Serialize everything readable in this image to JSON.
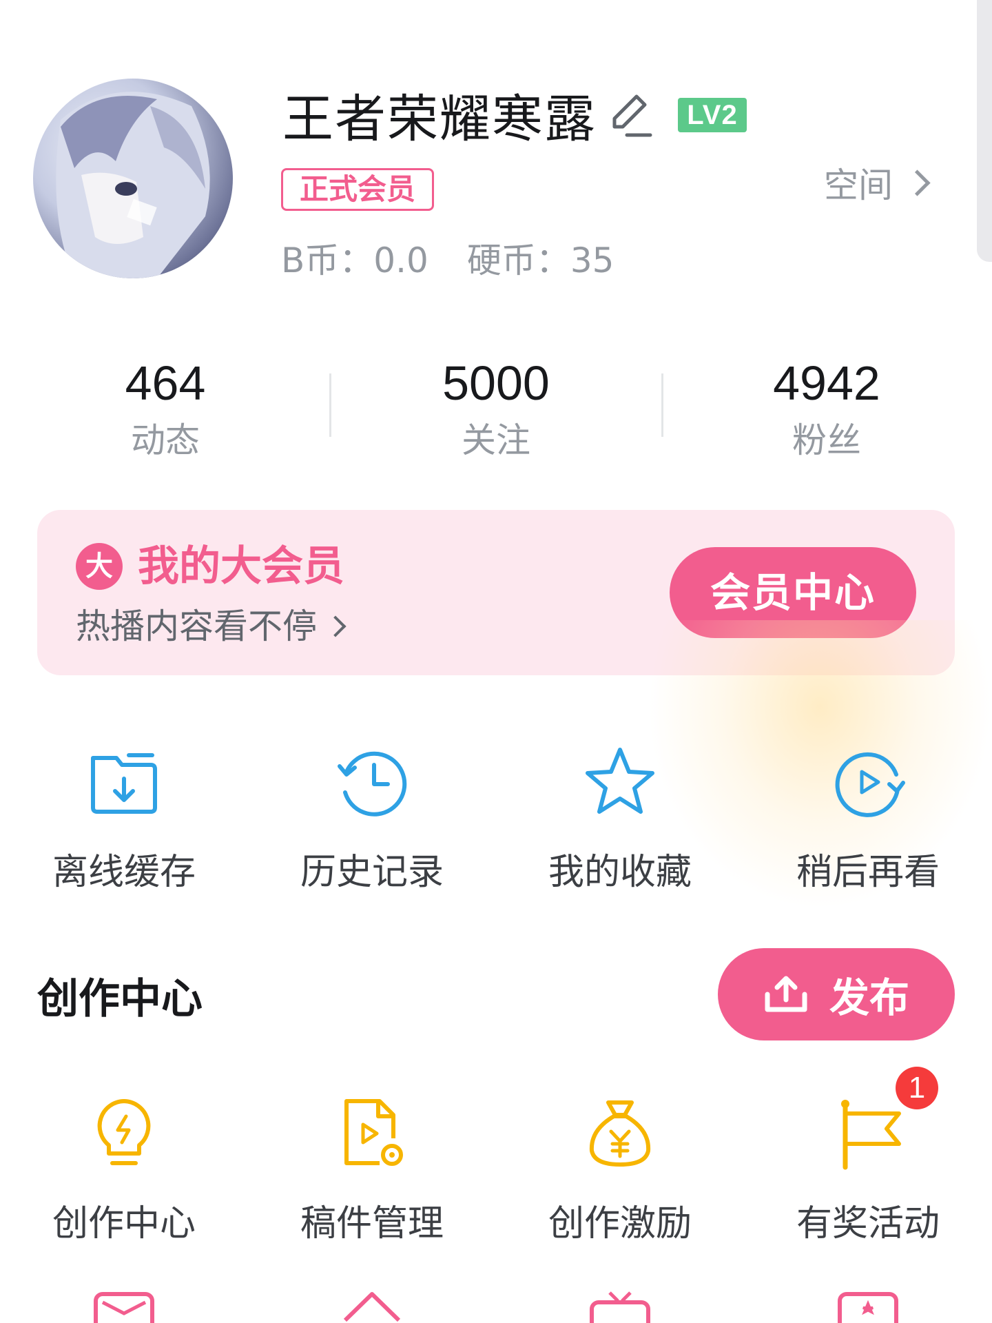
{
  "profile": {
    "username": "王者荣耀寒露",
    "level": "LV2",
    "member_badge": "正式会员",
    "space_label": "空间",
    "b_coin": "B币：0.0",
    "coins": "硬币：35"
  },
  "stats": [
    {
      "value": "464",
      "label": "动态"
    },
    {
      "value": "5000",
      "label": "关注"
    },
    {
      "value": "4942",
      "label": "粉丝"
    }
  ],
  "vip": {
    "icon_text": "大",
    "title": "我的大会员",
    "subtitle": "热播内容看不停",
    "button": "会员中心"
  },
  "quick_actions": [
    {
      "label": "离线缓存",
      "icon": "offline-cache-icon"
    },
    {
      "label": "历史记录",
      "icon": "history-icon"
    },
    {
      "label": "我的收藏",
      "icon": "favorites-star-icon"
    },
    {
      "label": "稍后再看",
      "icon": "watch-later-icon"
    }
  ],
  "creator": {
    "section_title": "创作中心",
    "publish_button": "发布",
    "items": [
      {
        "label": "创作中心",
        "icon": "lightbulb-icon"
      },
      {
        "label": "稿件管理",
        "icon": "manuscript-icon"
      },
      {
        "label": "创作激励",
        "icon": "money-bag-icon"
      },
      {
        "label": "有奖活动",
        "icon": "flag-icon",
        "badge": "1"
      }
    ]
  },
  "colors": {
    "accent_pink": "#f25d8e",
    "action_blue": "#2ea1e4",
    "creator_yellow": "#f7b500",
    "level_green": "#5cc98a"
  }
}
